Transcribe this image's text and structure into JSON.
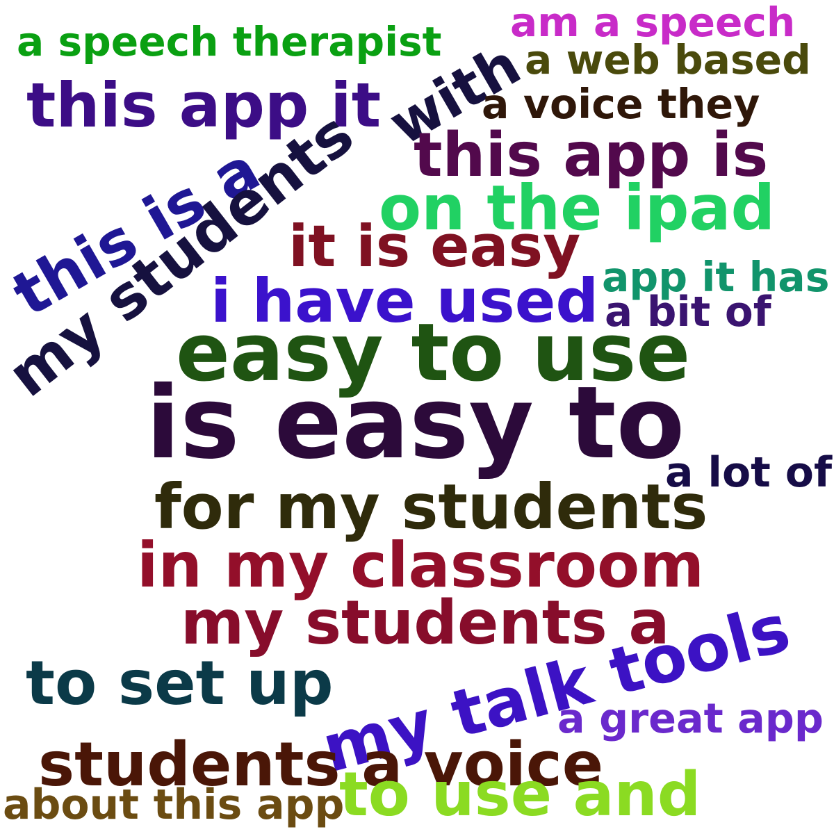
{
  "words": [
    {
      "text": "a speech therapist",
      "color": "#0aa012"
    },
    {
      "text": "am a speech",
      "color": "#c82bc8"
    },
    {
      "text": "a web based",
      "color": "#4a4a0c"
    },
    {
      "text": "this app it",
      "color": "#3c0d86"
    },
    {
      "text": "with",
      "color": "#16113f"
    },
    {
      "text": "a voice they",
      "color": "#2f1709"
    },
    {
      "text": "this app is",
      "color": "#52094c"
    },
    {
      "text": "this is a",
      "color": "#1f1794"
    },
    {
      "text": "my students",
      "color": "#16113f"
    },
    {
      "text": "on the ipad",
      "color": "#21d163"
    },
    {
      "text": "it is easy",
      "color": "#7f1122"
    },
    {
      "text": "app it has",
      "color": "#11946b"
    },
    {
      "text": "i have used",
      "color": "#3b12cc"
    },
    {
      "text": "a bit of",
      "color": "#3a1470"
    },
    {
      "text": "easy to use",
      "color": "#1f5412"
    },
    {
      "text": "is easy to",
      "color": "#2c0a3a"
    },
    {
      "text": "a lot of",
      "color": "#160c47"
    },
    {
      "text": "for my students",
      "color": "#2f2b0b"
    },
    {
      "text": "in my classroom",
      "color": "#930f2a"
    },
    {
      "text": "my students a",
      "color": "#870d2b"
    },
    {
      "text": "to set up",
      "color": "#0b3a48"
    },
    {
      "text": "my talk tools",
      "color": "#3c12c4"
    },
    {
      "text": "a great app",
      "color": "#6a29cc"
    },
    {
      "text": "students a voice",
      "color": "#4a1607"
    },
    {
      "text": "about this app",
      "color": "#6b4c12"
    },
    {
      "text": "to use and",
      "color": "#8bdb22"
    }
  ]
}
